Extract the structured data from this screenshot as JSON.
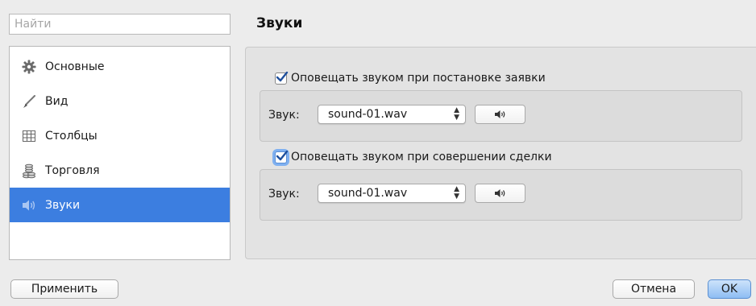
{
  "search": {
    "placeholder": "Найти",
    "value": ""
  },
  "sidebar": {
    "items": [
      {
        "label": "Основные",
        "icon": "gear-icon",
        "selected": false
      },
      {
        "label": "Вид",
        "icon": "brush-icon",
        "selected": false
      },
      {
        "label": "Столбцы",
        "icon": "table-icon",
        "selected": false
      },
      {
        "label": "Торговля",
        "icon": "coins-icon",
        "selected": false
      },
      {
        "label": "Звуки",
        "icon": "speaker-icon",
        "selected": true
      }
    ]
  },
  "page": {
    "title": "Звуки"
  },
  "order_sound": {
    "checkbox_label": "Оповещать звуком при постановке заявки",
    "checked": true,
    "sound_label": "Звук:",
    "sound_value": "sound-01.wav"
  },
  "deal_sound": {
    "checkbox_label": "Оповещать звуком при совершении сделки",
    "checked": true,
    "sound_label": "Звук:",
    "sound_value": "sound-01.wav"
  },
  "footer": {
    "apply_label": "Применить",
    "cancel_label": "Отмена",
    "ok_label": "OK"
  },
  "colors": {
    "accent": "#3c7ee0",
    "checkmark": "#1e4f9c"
  }
}
